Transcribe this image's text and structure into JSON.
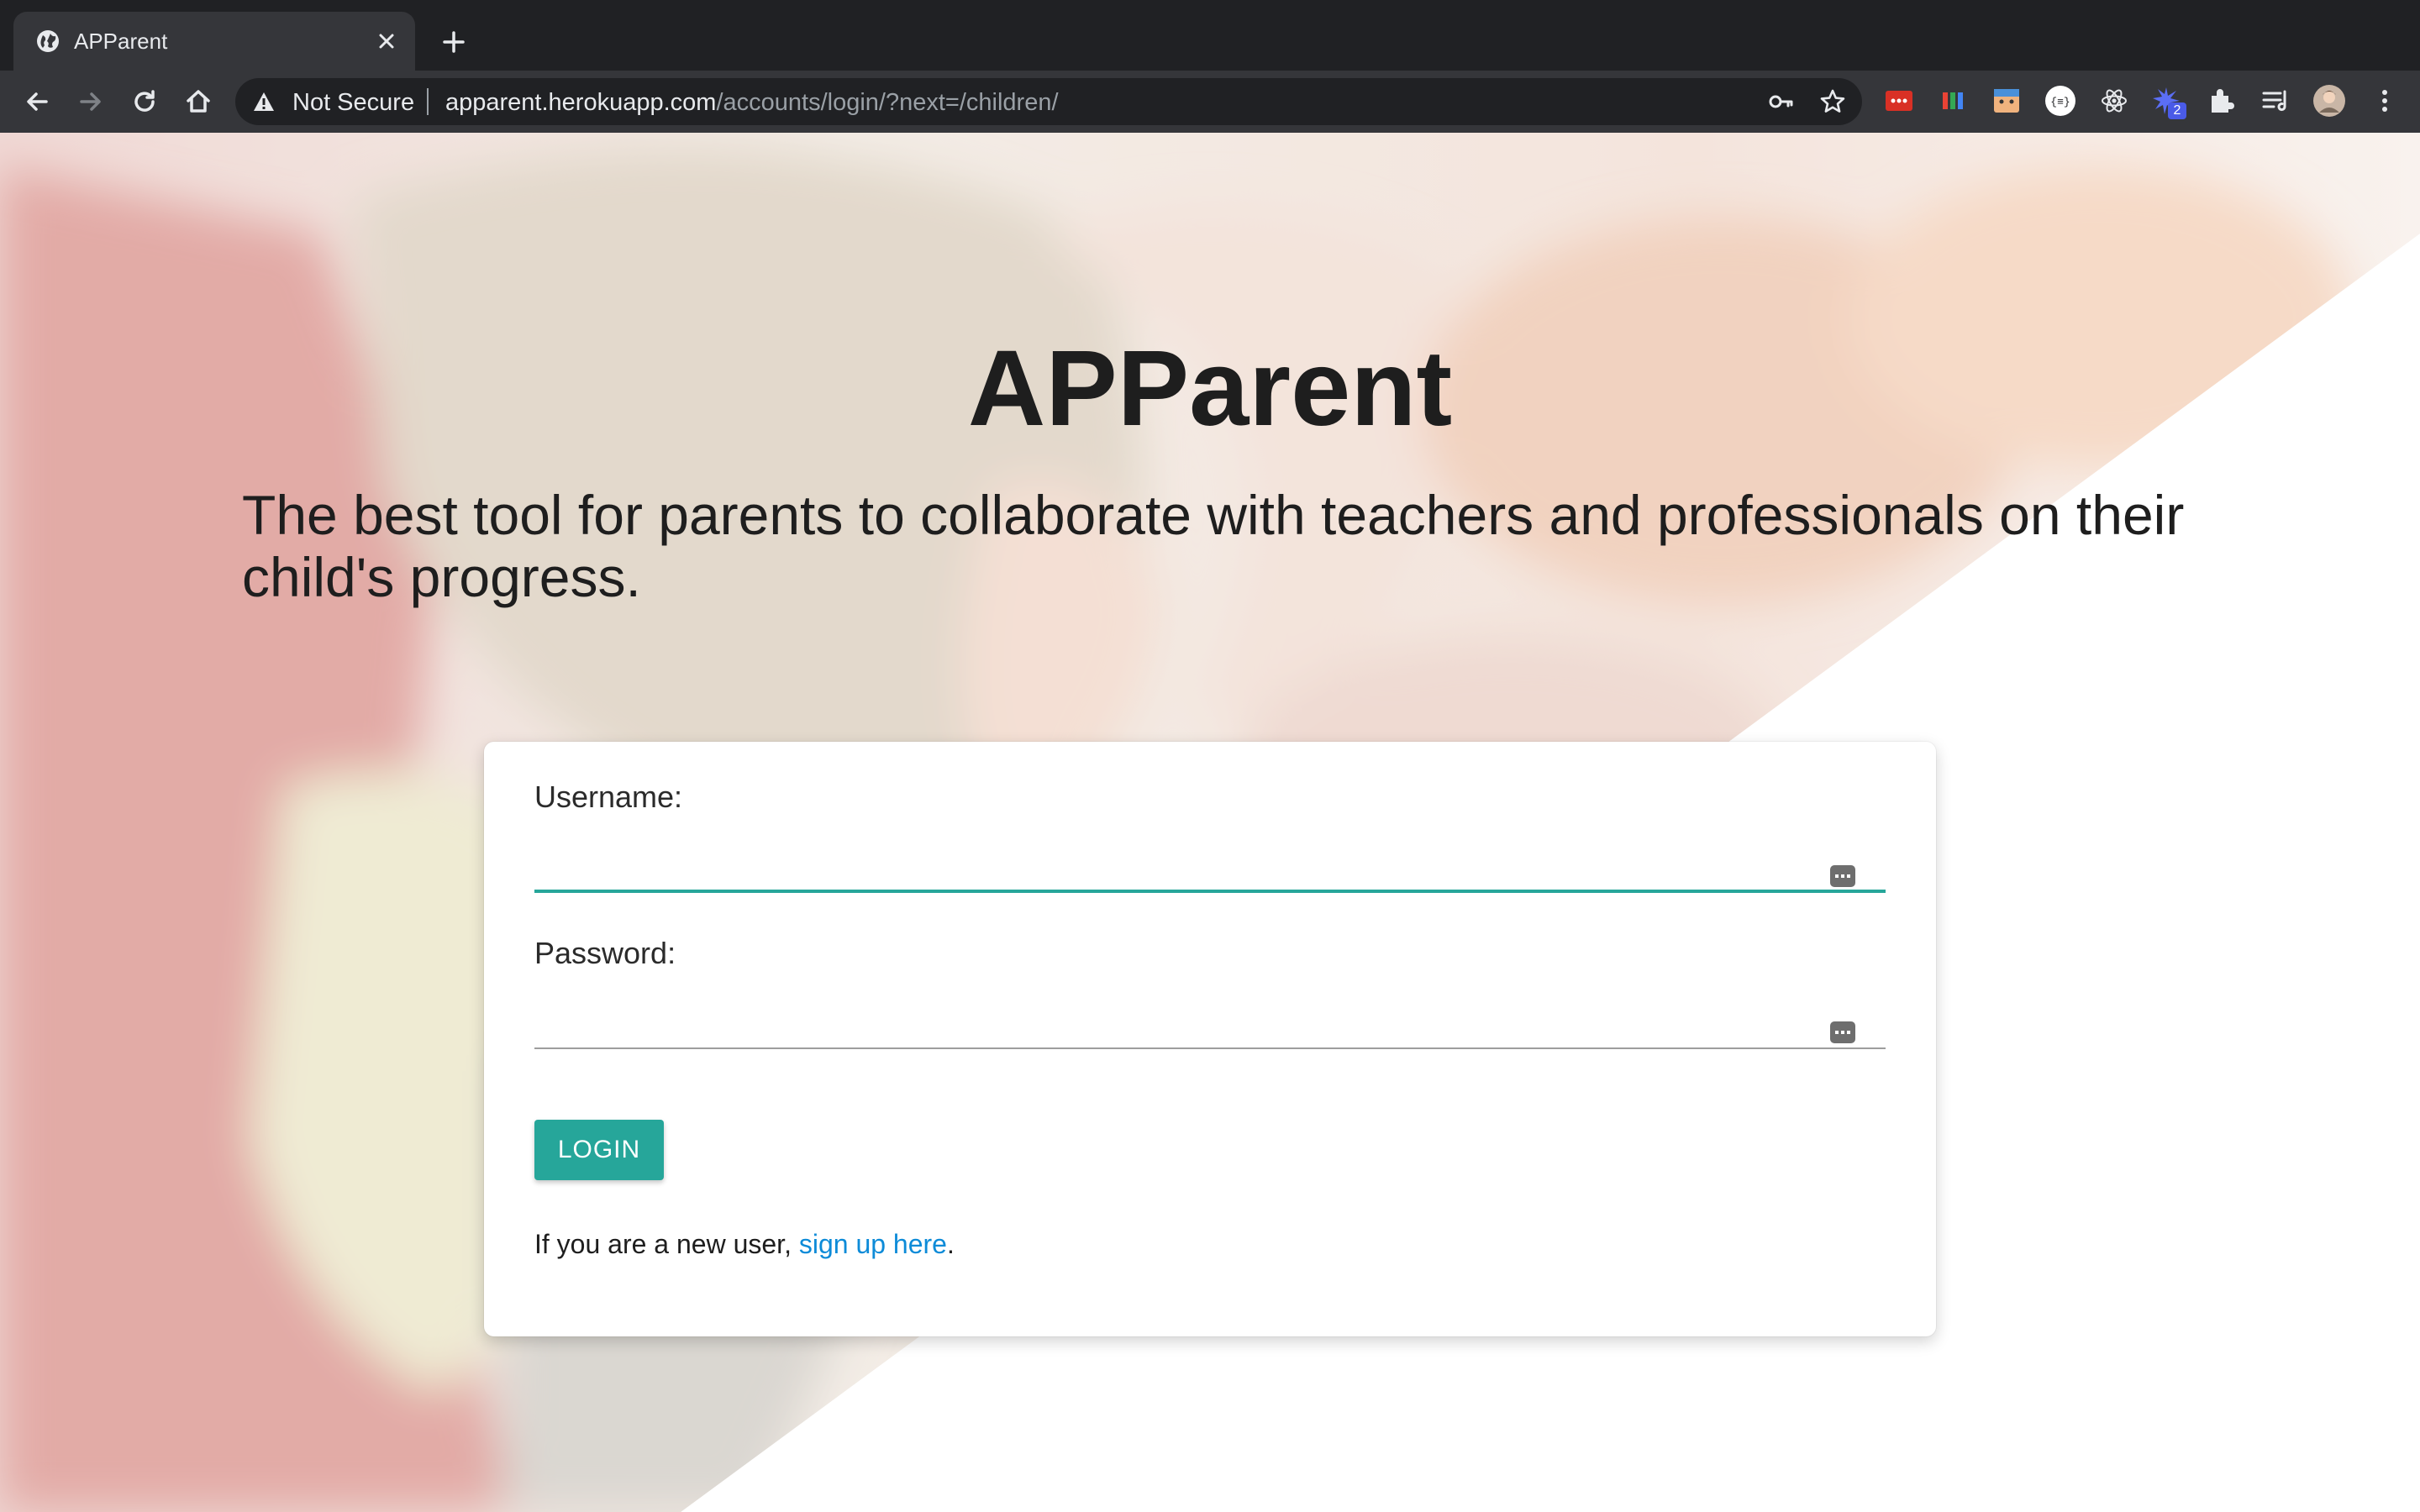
{
  "browser": {
    "tab_title": "APParent",
    "security_label": "Not Secure",
    "url_host": "apparent.herokuapp.com",
    "url_path": "/accounts/login/?next=/children/",
    "extension_badge": "2"
  },
  "page": {
    "app_title": "APParent",
    "tagline": "The best tool for parents to collaborate with teachers and professionals on their child's progress."
  },
  "login_form": {
    "username_label": "Username:",
    "username_value": "",
    "password_label": "Password:",
    "password_value": "",
    "login_button": "LOGIN",
    "signup_prefix": "If you are a new user, ",
    "signup_link": "sign up here",
    "signup_suffix": "."
  },
  "colors": {
    "accent": "#26a69a",
    "link": "#0d8bd8",
    "chrome_dark": "#202124",
    "chrome_toolbar": "#35363a"
  },
  "icons": [
    "globe-icon",
    "close-icon",
    "plus-icon",
    "back-icon",
    "forward-icon",
    "reload-icon",
    "home-icon",
    "warning-icon",
    "key-icon",
    "star-icon",
    "extensions-icon",
    "reading-list-icon",
    "profile-avatar",
    "kebab-menu-icon",
    "password-manager-icon"
  ]
}
